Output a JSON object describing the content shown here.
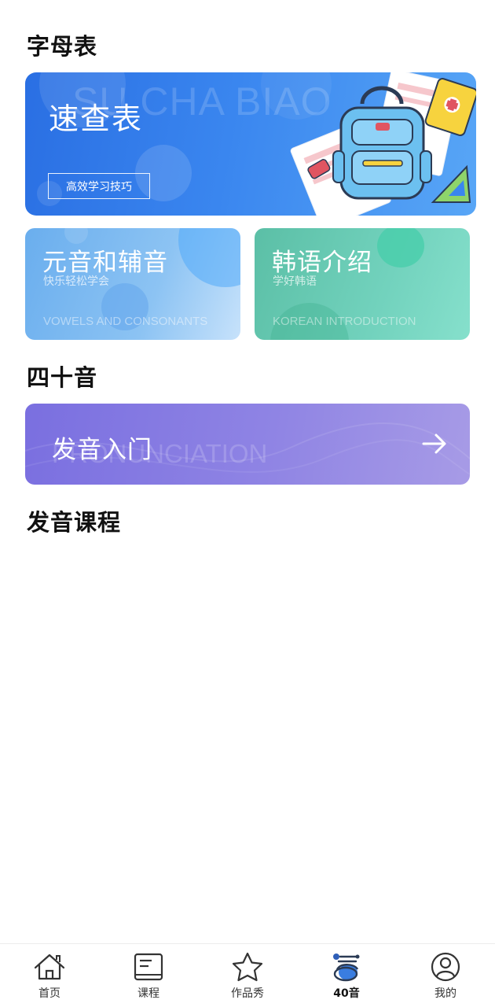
{
  "sections": {
    "alphabet": "字母表",
    "forty_sounds": "四十音",
    "courses": "发音课程"
  },
  "banner": {
    "title": "速查表",
    "watermark": "SU CHA BIAO",
    "button": "高效学习技巧"
  },
  "cards": {
    "vowels": {
      "title": "元音和辅音",
      "subtitle": "快乐轻松学会",
      "english": "VOWELS AND CONSONANTS"
    },
    "korean": {
      "title": "韩语介绍",
      "subtitle": "学好韩语",
      "english": "KOREAN INTRODUCTION"
    }
  },
  "pronunciation": {
    "title": "发音入门",
    "english": "PRONUNCIATION",
    "arrow_icon": "arrow-right-icon"
  },
  "nav": {
    "items": [
      {
        "label": "首页",
        "icon": "home-icon"
      },
      {
        "label": "课程",
        "icon": "book-icon"
      },
      {
        "label": "作品秀",
        "icon": "star-icon"
      },
      {
        "label": "40音",
        "icon": "forty-sounds-icon",
        "active": true
      },
      {
        "label": "我的",
        "icon": "user-icon"
      }
    ]
  },
  "colors": {
    "banner": "#2a6fe3",
    "vowels_card": "#6aaeee",
    "korean_card": "#5bbfa6",
    "pronunciation": "#7a6fe0"
  }
}
